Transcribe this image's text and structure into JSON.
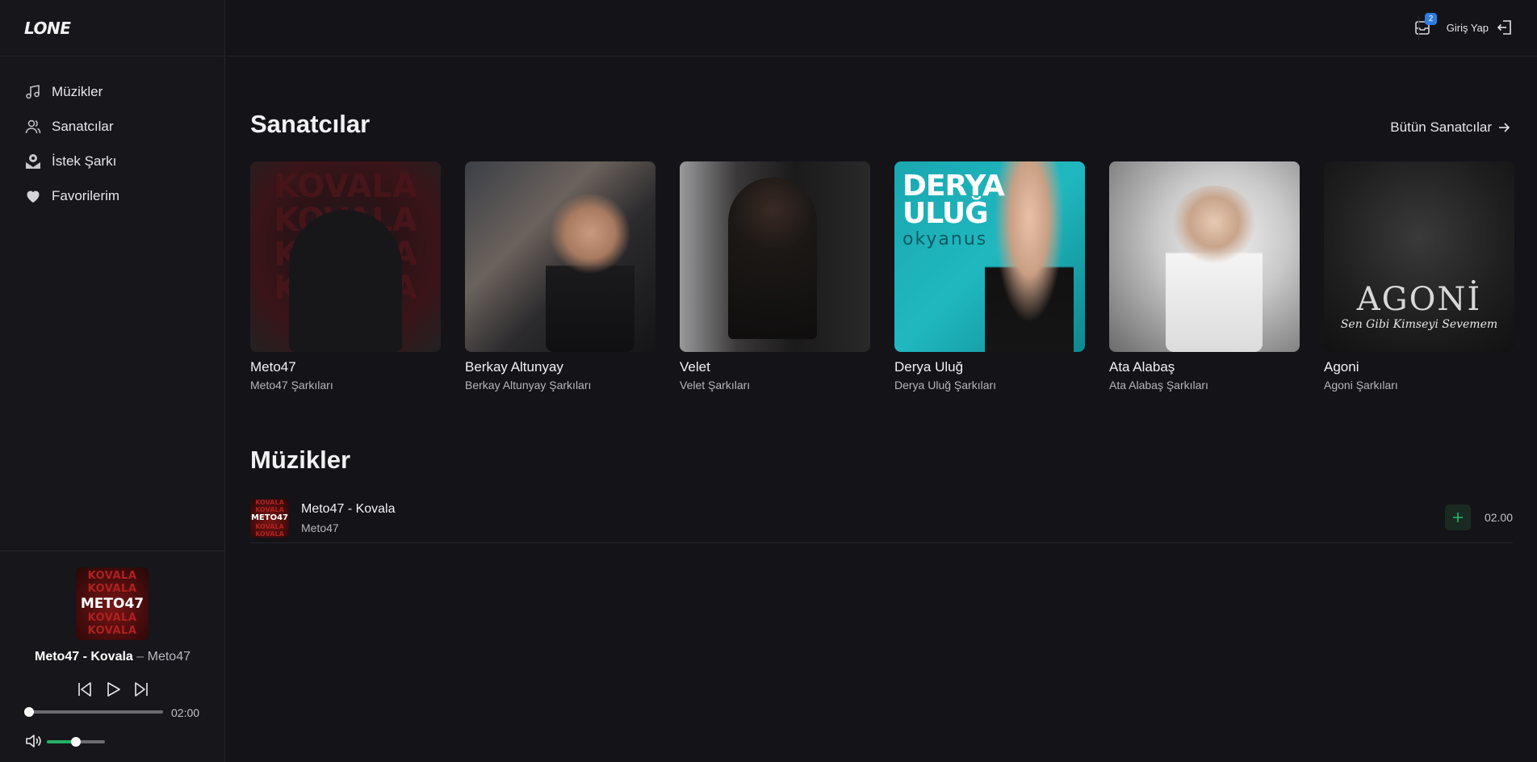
{
  "app": {
    "logo": "LONE"
  },
  "sidebar": {
    "items": [
      {
        "label": "Müzikler",
        "icon": "music-note-icon"
      },
      {
        "label": "Sanatcılar",
        "icon": "users-icon"
      },
      {
        "label": "İstek Şarkı",
        "icon": "mailbox-icon"
      },
      {
        "label": "Favorilerim",
        "icon": "heart-icon"
      }
    ]
  },
  "topbar": {
    "notification_count": "2",
    "login_label": "Giriş Yap"
  },
  "artists_section": {
    "title": "Sanatcılar",
    "see_all": "Bütün Sanatcılar",
    "items": [
      {
        "name": "Meto47",
        "subtitle": "Meto47 Şarkıları",
        "cover_text": "KOVALA"
      },
      {
        "name": "Berkay Altunyay",
        "subtitle": "Berkay Altunyay Şarkıları"
      },
      {
        "name": "Velet",
        "subtitle": "Velet Şarkıları"
      },
      {
        "name": "Derya Uluğ",
        "subtitle": "Derya Uluğ Şarkıları",
        "cover_title": "DERYA ULUĞ",
        "cover_subtitle": "okyanus"
      },
      {
        "name": "Ata Alabaş",
        "subtitle": "Ata Alabaş Şarkıları"
      },
      {
        "name": "Agoni",
        "subtitle": "Agoni Şarkıları",
        "cover_title": "AGONİ",
        "cover_subtitle": "Sen Gibi Kimseyi Sevemem"
      }
    ]
  },
  "tracks_section": {
    "title": "Müzikler",
    "tracks": [
      {
        "title": "Meto47 - Kovala",
        "artist": "Meto47",
        "duration": "02.00",
        "cover_main": "METO47",
        "cover_line": "KOVALA"
      }
    ]
  },
  "player": {
    "song": "Meto47 - Kovala",
    "separator": "–",
    "artist": "Meto47",
    "cover_main": "METO47",
    "cover_line": "KOVALA",
    "total_time": "02:00",
    "progress": 0.0,
    "volume": 0.5
  },
  "colors": {
    "background": "#141318",
    "sidebar": "#17161b",
    "accent_green": "#22b264",
    "badge_blue": "#2f7de1"
  }
}
